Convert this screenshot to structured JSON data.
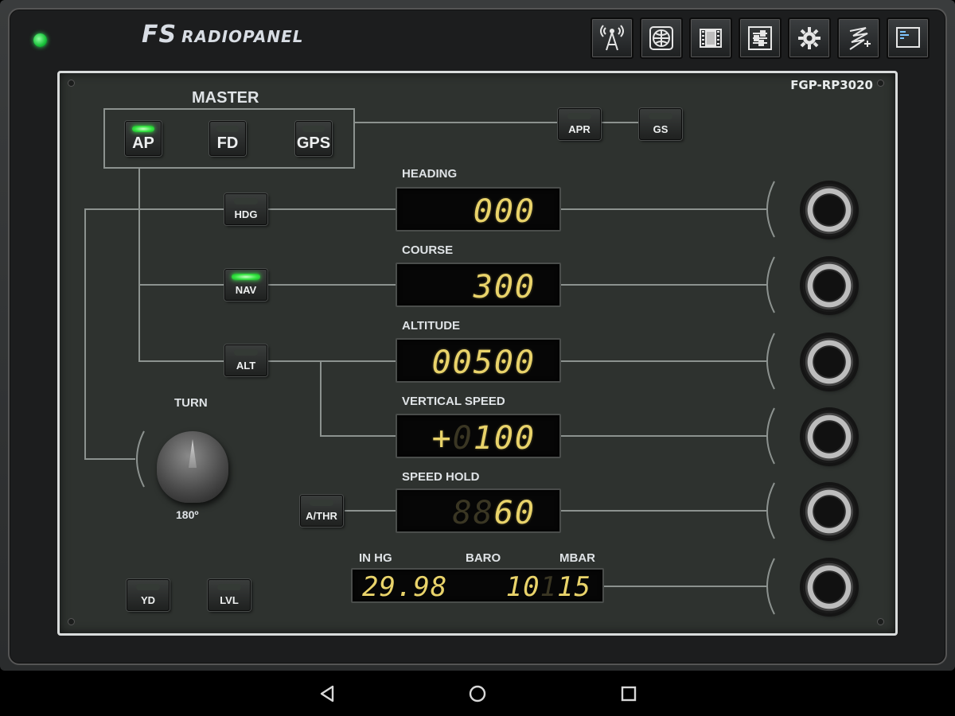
{
  "app": {
    "brand_fs": "FS",
    "brand_name": "RADIOPANEL",
    "model": "FGP-RP3020"
  },
  "toolbar": [
    {
      "icon": "radio-tower-icon"
    },
    {
      "icon": "globe-map-icon"
    },
    {
      "icon": "filmstrip-icon"
    },
    {
      "icon": "sliders-icon"
    },
    {
      "icon": "gear-icon"
    },
    {
      "icon": "lightning-plus-icon"
    },
    {
      "icon": "terminal-screen-icon"
    }
  ],
  "master": {
    "label": "MASTER",
    "buttons": [
      {
        "label": "AP",
        "lit": true
      },
      {
        "label": "FD",
        "lit": false
      },
      {
        "label": "GPS",
        "lit": false
      }
    ]
  },
  "approach": {
    "apr_label": "APR",
    "gs_label": "GS"
  },
  "modes": {
    "hdg": "HDG",
    "nav": "NAV",
    "alt": "ALT",
    "athr": "A/THR",
    "yd": "YD",
    "lvl": "LVL"
  },
  "heading": {
    "label": "HEADING",
    "value": "000"
  },
  "course": {
    "label": "COURSE",
    "value": "300"
  },
  "altitude": {
    "label": "ALTITUDE",
    "value": "00500"
  },
  "vertical_speed": {
    "label": "VERTICAL SPEED",
    "sign": "+",
    "ghost": "0",
    "value": "100"
  },
  "speed_hold": {
    "label": "SPEED HOLD",
    "ghost": "88",
    "value": "60"
  },
  "baro": {
    "inhg_label": "IN HG",
    "baro_label": "BARO",
    "mbar_label": "MBAR",
    "inhg_value": "29.98",
    "mbar_value_a": "10",
    "mbar_ghost": "1",
    "mbar_value_b": "15"
  },
  "turn": {
    "label": "TURN",
    "value": "180º"
  },
  "colors": {
    "led_green": "#34e641",
    "segment_amber": "#e9d36a",
    "panel_bg": "#2e322f"
  }
}
